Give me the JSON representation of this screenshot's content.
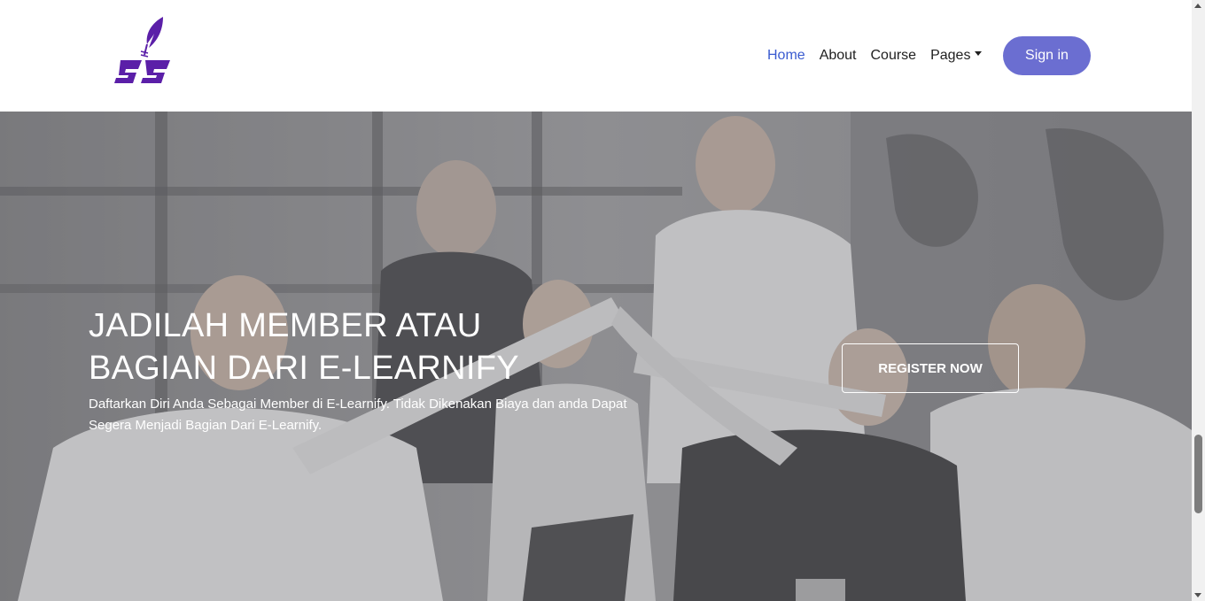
{
  "navbar": {
    "logo_alt": "E-Learnify logo",
    "links": [
      {
        "label": "Home",
        "active": true
      },
      {
        "label": "About",
        "active": false
      },
      {
        "label": "Course",
        "active": false
      },
      {
        "label": "Pages",
        "active": false,
        "dropdown": true
      }
    ],
    "signin_label": "Sign in",
    "colors": {
      "active_link": "#3a5bd0",
      "signin_bg": "#6b6ed1",
      "logo": "#5b1fa8"
    }
  },
  "hero": {
    "title_line1": "JADILAH MEMBER ATAU",
    "title_line2": "BAGIAN DARI E-LEARNIFY",
    "description": "Daftarkan Diri Anda Sebagai Member di E-Learnify. Tidak Dikenakan Biaya dan anda Dapat Segera Menjadi Bagian Dari E-Learnify.",
    "register_label": "REGISTER NOW",
    "background_icon": "team-high-five-photo"
  }
}
